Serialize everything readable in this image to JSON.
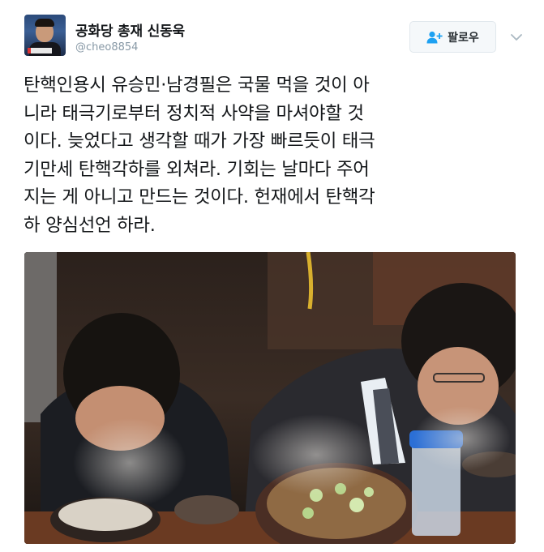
{
  "user": {
    "display_name": "공화당 총재 신동욱",
    "handle": "@cheo8854"
  },
  "follow_button": {
    "label": "팔로우"
  },
  "tweet": {
    "text": "탄핵인용시 유승민·남경필은 국물 먹을 것이 아\n니라 태극기로부터 정치적 사약을 마셔야할 것\n이다. 늦었다고 생각할 때가 가장 빠르듯이 태극\n기만세 탄핵각하를 외쳐라. 기회는 날마다 주어\n지는 게 아니고 만드는 것이다. 헌재에서 탄핵각\n하 양심선언 하라."
  },
  "colors": {
    "text": "#14171a",
    "secondary": "#8899a6",
    "accent": "#1da1f2"
  },
  "icons": {
    "follow": "add-user-icon",
    "more": "chevron-down-icon"
  }
}
